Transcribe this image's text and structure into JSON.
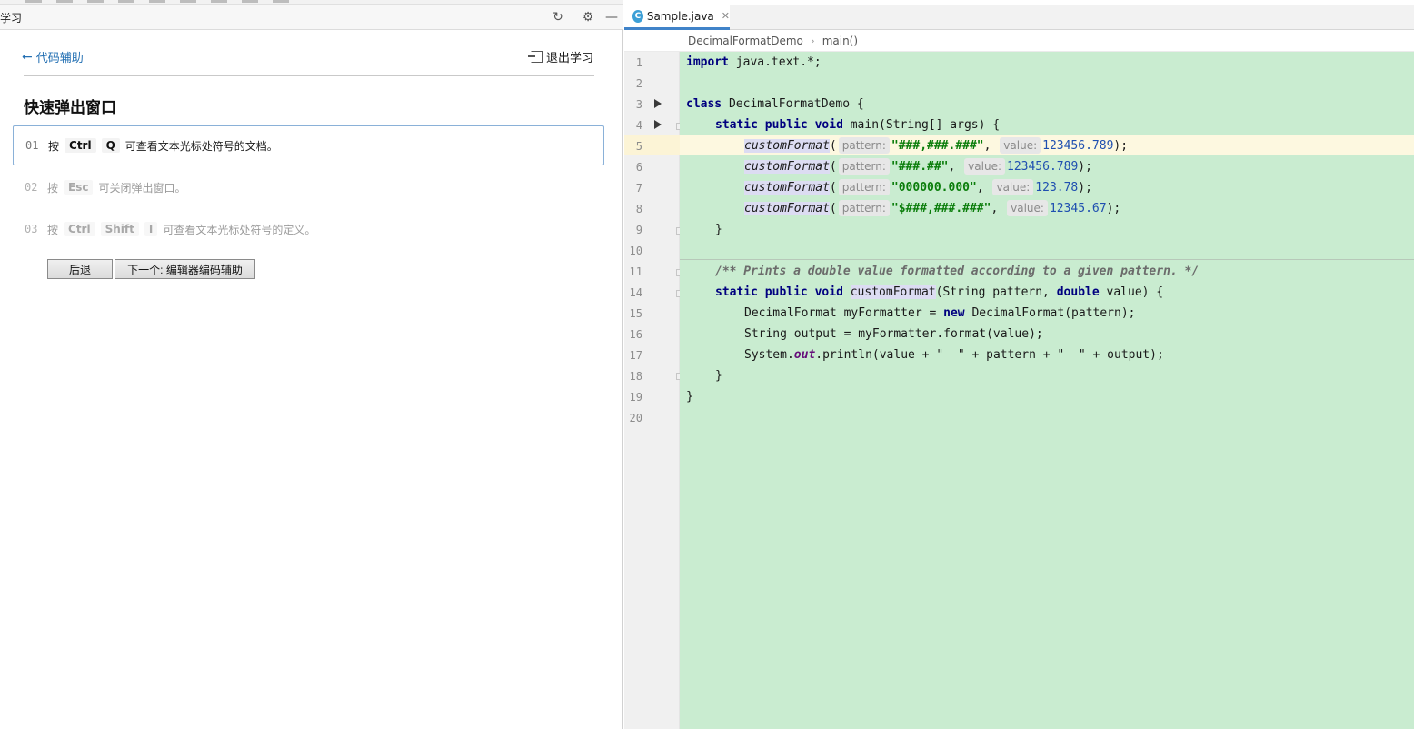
{
  "left_panel": {
    "title": "学习",
    "back_link": "代码辅助",
    "exit_link": "退出学习",
    "lesson_title": "快速弹出窗口",
    "steps": [
      {
        "num": "01",
        "prefix": "按",
        "keys": [
          "Ctrl",
          "Q"
        ],
        "text": "可查看文本光标处符号的文档。"
      },
      {
        "num": "02",
        "prefix": "按",
        "keys": [
          "Esc"
        ],
        "text": "可关闭弹出窗口。"
      },
      {
        "num": "03",
        "prefix": "按",
        "keys": [
          "Ctrl",
          "Shift",
          "I"
        ],
        "text": "可查看文本光标处符号的定义。"
      }
    ],
    "buttons": {
      "back": "后退",
      "next": "下一个: 编辑器编码辅助"
    }
  },
  "editor": {
    "tab": {
      "filename": "Sample.java",
      "icon_letter": "C"
    },
    "breadcrumbs": [
      "DecimalFormatDemo",
      "main()"
    ],
    "line_numbers": [
      "1",
      "2",
      "3",
      "4",
      "5",
      "6",
      "7",
      "8",
      "9",
      "10",
      "11",
      "14",
      "15",
      "16",
      "17",
      "18",
      "19",
      "20"
    ],
    "code": {
      "l1_import": "import",
      "l1_rest": " java.text.*;",
      "l3_class": "class",
      "l3_name": " DecimalFormatDemo {",
      "l4_static": "static",
      "l4_public": "public",
      "l4_void": "void",
      "l4_rest": " main(String[] args) {",
      "call_fn": "customFormat",
      "hint_pattern": "pattern:",
      "hint_value": "value:",
      "calls": [
        {
          "pattern": "\"###,###.###\"",
          "value": "123456.789"
        },
        {
          "pattern": "\"###.##\"",
          "value": "123456.789"
        },
        {
          "pattern": "\"000000.000\"",
          "value": "123.78"
        },
        {
          "pattern": "\"$###,###.###\"",
          "value": "12345.67"
        }
      ],
      "close_brace": "}",
      "l11_comment": "/** Prints a double value formatted according to a given pattern. */",
      "l14_static": "static",
      "l14_public": "public",
      "l14_void": "void",
      "l14_fn": "customFormat",
      "l14_rest_a": "(String pattern, ",
      "l14_double": "double",
      "l14_rest_b": " value) {",
      "l15_a": "DecimalFormat myFormatter = ",
      "l15_new": "new",
      "l15_b": " DecimalFormat(pattern);",
      "l16": "String output = myFormatter.format(value);",
      "l17_a": "System.",
      "l17_out": "out",
      "l17_b": ".println(value + \"  \" + pattern + \"  \" + output);"
    }
  },
  "colors": {
    "code_bg": "#c9ecd0",
    "current_line": "#fdf8e0",
    "keyword": "#00007f",
    "string": "#0a7d0a",
    "number": "#1f4fb0",
    "link": "#2470b3"
  }
}
